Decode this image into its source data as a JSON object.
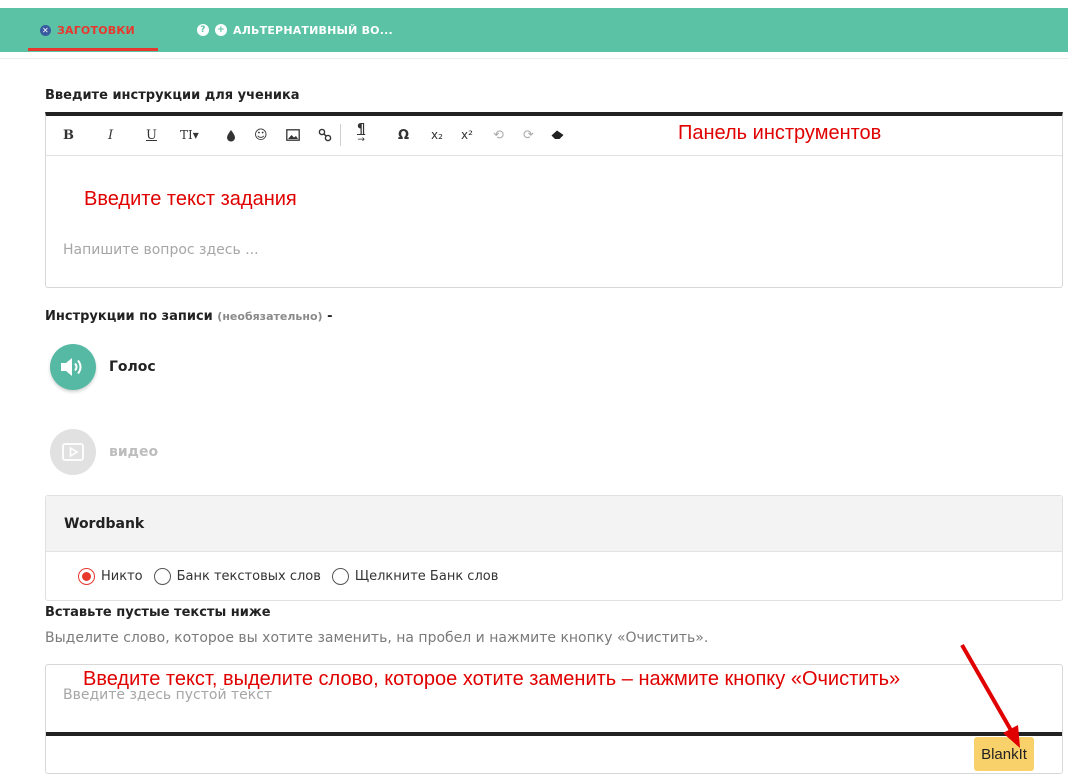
{
  "tabs": [
    {
      "label": "ЗАГОТОВКИ",
      "icon": "close-circle-icon",
      "active": true
    },
    {
      "label": "АЛЬТЕРНАТИВНЫЙ ВО...",
      "icons": [
        "help-icon",
        "add-circle-icon"
      ],
      "active": false
    }
  ],
  "instructions": {
    "heading": "Введите инструкции для ученика",
    "toolbar": {
      "buttons": [
        "B",
        "I",
        "U",
        "TI▾",
        "drop",
        "☺",
        "image",
        "link",
        "¶",
        "Ω",
        "x₂",
        "x²",
        "undo",
        "redo",
        "eraser"
      ],
      "annotation": "Панель инструментов"
    },
    "annotation": "Введите текст задания",
    "placeholder": "Напишите вопрос здесь ..."
  },
  "recording": {
    "heading": "Инструкции по записи",
    "optional": "(необязательно)",
    "dash": "-",
    "voice_label": "Голос",
    "video_label": "видео"
  },
  "wordbank": {
    "title": "Wordbank",
    "options": [
      "Никто",
      "Банк текстовых слов",
      "Щелкните Банк слов"
    ],
    "selected_index": 0
  },
  "blanks": {
    "heading": "Вставьте пустые тексты ниже",
    "hint": "Выделите слово, которое вы хотите заменить, на пробел и нажмите кнопку «Очистить».",
    "placeholder": "Введите здесь пустой текст",
    "annotation": "Введите текст, выделите слово, которое хотите заменить – нажмите кнопку «Очистить»",
    "button_label": "BlankIt"
  },
  "colors": {
    "tabbar": "#5bc2a5",
    "active_tab": "#e8382e",
    "annotation": "#e00000",
    "blankit_button": "#f8d16a"
  }
}
